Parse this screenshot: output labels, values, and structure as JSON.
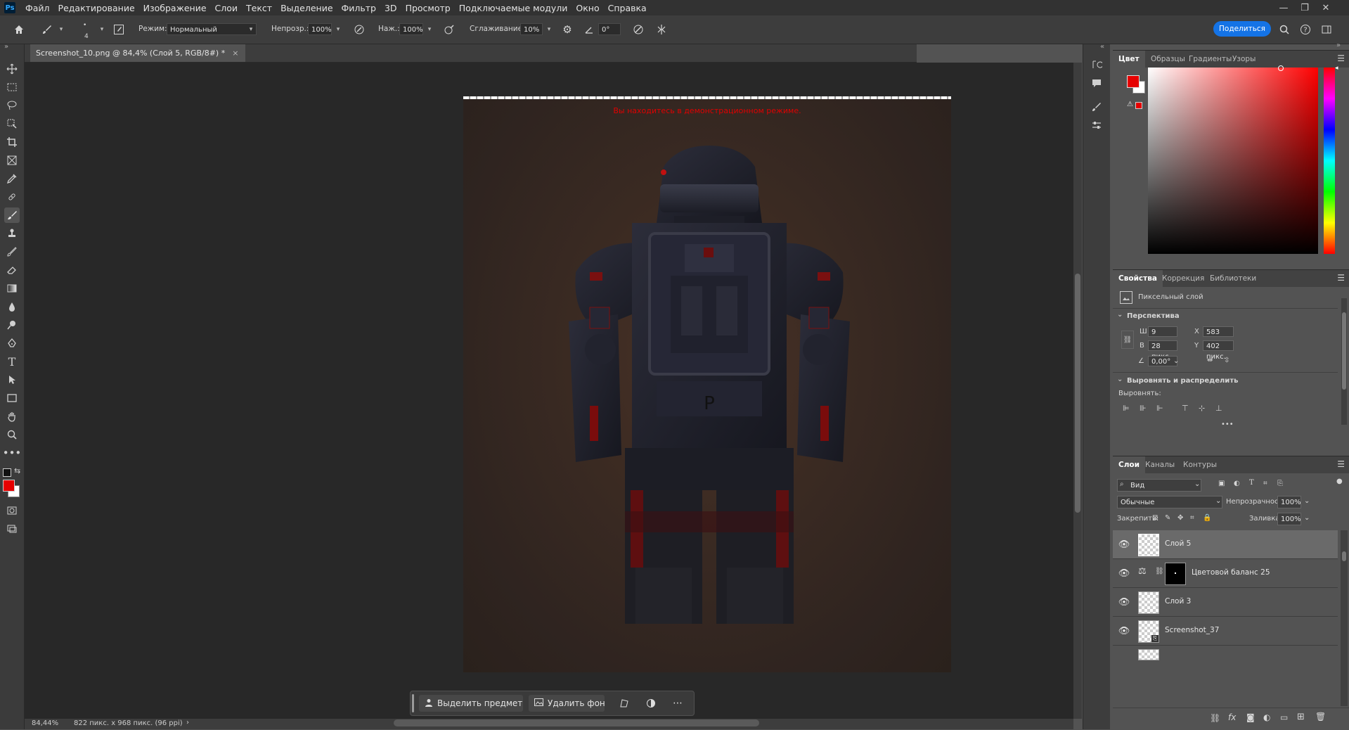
{
  "menubar": {
    "logo": "Ps",
    "items": [
      "Файл",
      "Редактирование",
      "Изображение",
      "Слои",
      "Текст",
      "Выделение",
      "Фильтр",
      "3D",
      "Просмотр",
      "Подключаемые модули",
      "Окно",
      "Справка"
    ],
    "window_controls": {
      "minimize": "—",
      "restore": "❐",
      "close": "✕"
    }
  },
  "options": {
    "brush_size": "4",
    "mode_label": "Режим:",
    "mode_value": "Нормальный",
    "opacity_label": "Непрозр.:",
    "opacity_value": "100%",
    "pressure_label": "Наж.:",
    "pressure_value": "100%",
    "smoothing_label": "Сглаживание:",
    "smoothing_value": "10%",
    "angle_value": "0°",
    "share_label": "Поделиться"
  },
  "document": {
    "tab_title": "Screenshot_10.png @ 84,4% (Слой 5, RGB/8#) *",
    "tab_close": "×",
    "demo_notice": "Вы находитесь в демонстрационном режиме."
  },
  "context_bar": {
    "select_subject": "Выделить предмет",
    "remove_bg": "Удалить фон",
    "more": "⋯"
  },
  "status": {
    "zoom": "84,44%",
    "dimensions": "822 пикс. x 968 пикс. (96 ppi)",
    "arrow": "›"
  },
  "color_panel": {
    "tabs": [
      "Цвет",
      "Образцы",
      "Градиенты",
      "Узоры"
    ],
    "foreground": "#e60000",
    "background": "#ffffff"
  },
  "properties_panel": {
    "tabs": [
      "Свойства",
      "Коррекция",
      "Библиотеки"
    ],
    "layer_type": "Пиксельный слой",
    "section_transform": "Перспектива",
    "w_label": "Ш",
    "w_value": "9 пикс.",
    "h_label": "В",
    "h_value": "28 пикс.",
    "x_label": "X",
    "x_value": "583 пикс.",
    "y_label": "Y",
    "y_value": "402 пикс.",
    "angle_value": "0,00°",
    "section_align": "Выровнять и распределить",
    "align_label": "Выровнять:",
    "more": "•••"
  },
  "layers_panel": {
    "tabs": [
      "Слои",
      "Каналы",
      "Контуры"
    ],
    "search_label": "Вид",
    "blend_mode": "Обычные",
    "opacity_label": "Непрозрачность:",
    "opacity_value": "100%",
    "lock_label": "Закрепить:",
    "fill_label": "Заливка:",
    "fill_value": "100%",
    "layers": [
      {
        "name": "Слой 5",
        "selected": true
      },
      {
        "name": "Цветовой баланс 25",
        "selected": false
      },
      {
        "name": "Слой 3",
        "selected": false
      },
      {
        "name": "Screenshot_37",
        "selected": false
      }
    ]
  }
}
